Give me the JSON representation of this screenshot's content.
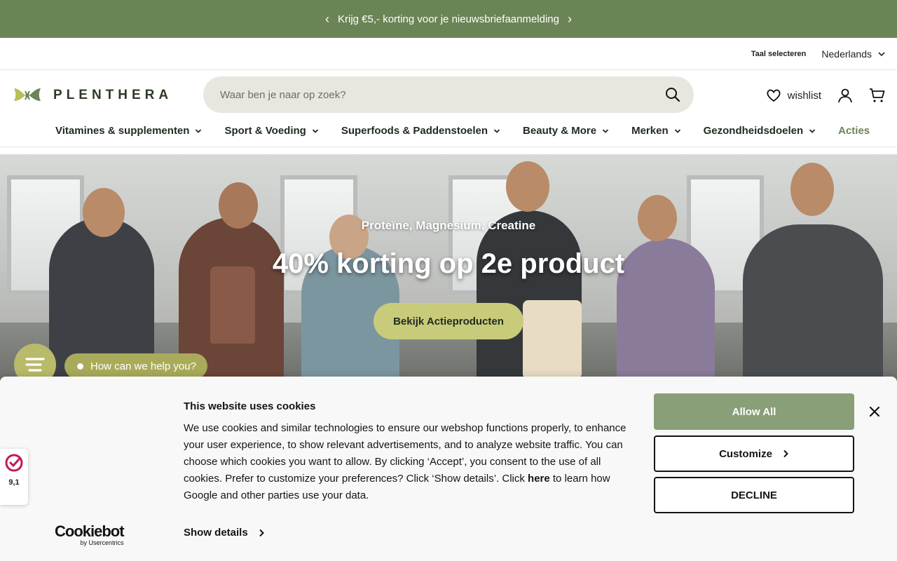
{
  "announcement": {
    "text": "Krijg €5,- korting voor je nieuwsbriefaanmelding"
  },
  "language": {
    "label": "Taal selecteren",
    "selected": "Nederlands"
  },
  "header": {
    "logo_text": "PLENTHERA",
    "search_placeholder": "Waar ben je naar op zoek?",
    "wishlist_label": "wishlist"
  },
  "nav": {
    "items": [
      {
        "label": "Vitamines & supplementen"
      },
      {
        "label": "Sport & Voeding"
      },
      {
        "label": "Superfoods & Paddenstoelen"
      },
      {
        "label": "Beauty & More"
      },
      {
        "label": "Merken"
      },
      {
        "label": "Gezondheidsdoelen"
      }
    ],
    "highlight_label": "Acties"
  },
  "hero": {
    "subtitle": "Proteïne, Magnesium, Creatine",
    "title": "40% korting op 2e product",
    "button_label": "Bekijk Actieproducten"
  },
  "chat": {
    "bubble_text": "How can we help you?"
  },
  "cookie": {
    "title": "This website uses cookies",
    "text_before": "We use cookies and similar technologies to ensure our webshop functions properly, to enhance your user experience, to show relevant advertisements, and to analyze website traffic. You can choose which cookies you want to allow. By clicking ‘Accept’, you consent to the use of all cookies. Prefer to customize your preferences? Click ‘Show details’. Click ",
    "link_here": "here",
    "text_after": " to learn how Google and other parties use your data.",
    "show_details": "Show details",
    "allow_all": "Allow All",
    "customize": "Customize",
    "decline": "DECLINE",
    "brand": "Cookiebot",
    "brand_by": "by Usercentrics"
  },
  "trust": {
    "score": "9,1"
  },
  "colors": {
    "brand_green": "#6b8456",
    "accent_olive": "#c8cb7a",
    "allow_button": "#889f78"
  }
}
